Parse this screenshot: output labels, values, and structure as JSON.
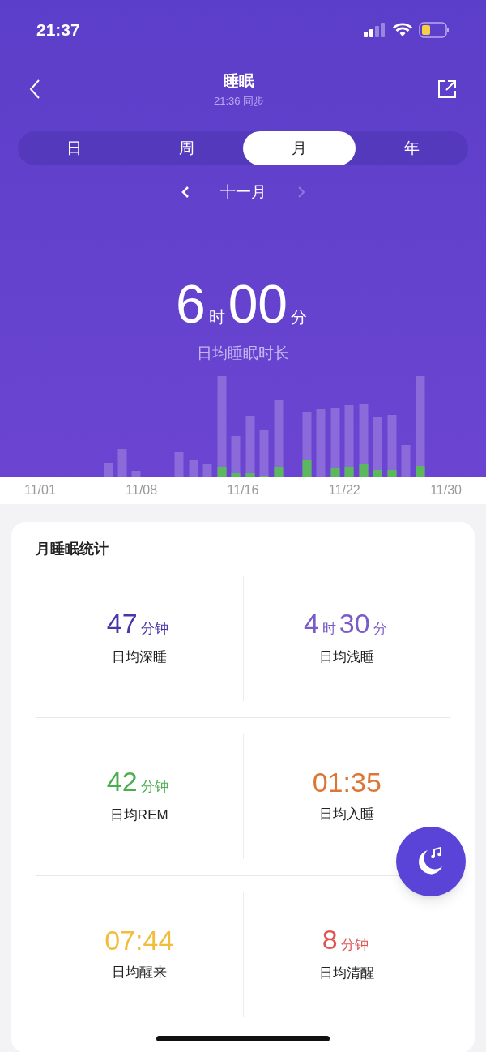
{
  "status_bar": {
    "time": "21:37"
  },
  "header": {
    "title": "睡眠",
    "subtitle": "21:36 同步"
  },
  "tabs": [
    {
      "label": "日",
      "selected": false
    },
    {
      "label": "周",
      "selected": false
    },
    {
      "label": "月",
      "selected": true
    },
    {
      "label": "年",
      "selected": false
    }
  ],
  "period": {
    "label": "十一月",
    "next_disabled": true
  },
  "summary": {
    "parts": [
      {
        "number": "6",
        "unit": "时"
      },
      {
        "number": "00",
        "unit": "分"
      }
    ],
    "label": "日均睡眠时长"
  },
  "chart_axis": [
    "11/01",
    "11/08",
    "11/16",
    "11/22",
    "11/30"
  ],
  "stats_card": {
    "title": "月睡眠统计",
    "stats": [
      {
        "parts": [
          {
            "number": "47",
            "unit": "分钟"
          }
        ],
        "label": "日均深睡",
        "color": "#4b36a8"
      },
      {
        "parts": [
          {
            "number": "4",
            "unit": "时"
          },
          {
            "number": "30",
            "unit": "分"
          }
        ],
        "label": "日均浅睡",
        "color": "#7a5cc9"
      },
      {
        "parts": [
          {
            "number": "42",
            "unit": "分钟"
          }
        ],
        "label": "日均REM",
        "color": "#4cae50"
      },
      {
        "parts": [
          {
            "number": "01:35"
          }
        ],
        "label": "日均入睡",
        "color": "#dc7634"
      },
      {
        "parts": [
          {
            "number": "07:44"
          }
        ],
        "label": "日均醒来",
        "color": "#f0be3c"
      },
      {
        "parts": [
          {
            "number": "8",
            "unit": "分钟"
          }
        ],
        "label": "日均清醒",
        "color": "#e05252"
      }
    ]
  }
}
